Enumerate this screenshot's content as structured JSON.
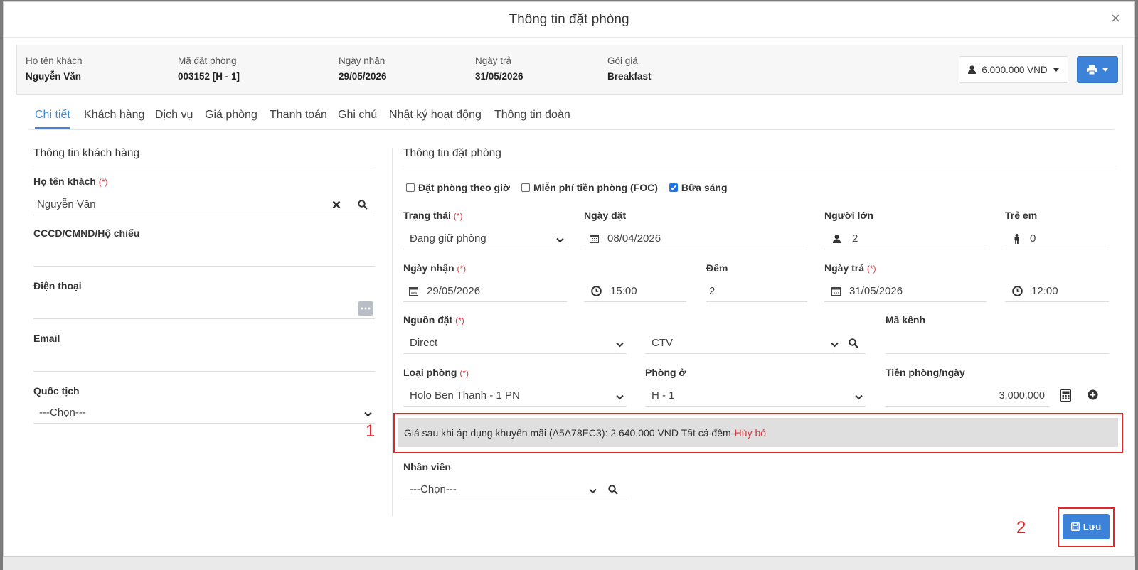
{
  "modal": {
    "title": "Thông tin đặt phòng",
    "close": "×"
  },
  "summary": {
    "guest_label": "Họ tên khách",
    "guest_value": "Nguyễn Văn",
    "code_label": "Mã đặt phòng",
    "code_value": "003152 [H - 1]",
    "checkin_label": "Ngày nhận",
    "checkin_value": "29/05/2026",
    "checkout_label": "Ngày trả",
    "checkout_value": "31/05/2026",
    "plan_label": "Gói giá",
    "plan_value": "Breakfast",
    "price_button": "6.000.000 VND"
  },
  "tabs": [
    "Chi tiết",
    "Khách hàng",
    "Dịch vụ",
    "Giá phòng",
    "Thanh toán",
    "Ghi chú",
    "Nhật ký hoạt động",
    "Thông tin đoàn"
  ],
  "left": {
    "title": "Thông tin khách hàng",
    "name_label": "Họ tên khách",
    "name_value": "Nguyễn Văn",
    "id_label": "CCCD/CMND/Hộ chiếu",
    "phone_label": "Điện thoại",
    "email_label": "Email",
    "nationality_label": "Quốc tịch",
    "nationality_value": "---Chọn---"
  },
  "right": {
    "title": "Thông tin đặt phòng",
    "checks": [
      {
        "label": "Đặt phòng theo giờ",
        "checked": false
      },
      {
        "label": "Miễn phí tiền phòng (FOC)",
        "checked": false
      },
      {
        "label": "Bữa sáng",
        "checked": true
      }
    ],
    "status_label": "Trạng thái",
    "status_value": "Đang giữ phòng",
    "booked_label": "Ngày đặt",
    "booked_value": "08/04/2026",
    "adults_label": "Người lớn",
    "adults_value": "2",
    "children_label": "Trẻ em",
    "children_value": "0",
    "checkin_label": "Ngày nhận",
    "checkin_value": "29/05/2026",
    "checkin_time": "15:00",
    "nights_label": "Đêm",
    "nights_value": "2",
    "checkout_label": "Ngày trả",
    "checkout_value": "31/05/2026",
    "checkout_time": "12:00",
    "source_label": "Nguồn đặt",
    "source_value": "Direct",
    "source2_value": "CTV",
    "channel_label": "Mã kênh",
    "roomtype_label": "Loại phòng",
    "roomtype_value": "Holo Ben Thanh - 1 PN",
    "room_label": "Phòng ở",
    "room_value": "H - 1",
    "rate_label": "Tiền phòng/ngày",
    "rate_value": "3.000.000",
    "promo_text": "Giá sau khi áp dụng khuyến mãi (A5A78EC3): 2.640.000 VND Tất cả đêm",
    "promo_cancel": "Hủy bỏ",
    "staff_label": "Nhân viên",
    "staff_value": "---Chọn---"
  },
  "required_mark": "(*)",
  "annotations": {
    "mark1": "1",
    "mark2": "2"
  },
  "save_label": "Lưu",
  "colors": {
    "primary": "#3c82d9",
    "highlight": "#e0262b",
    "tab_active": "#3a8ad6"
  }
}
